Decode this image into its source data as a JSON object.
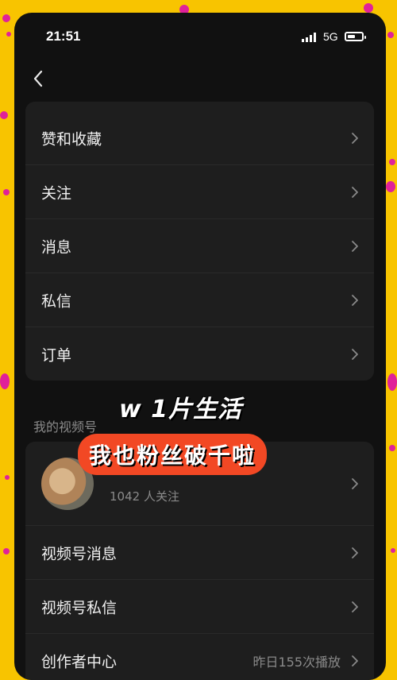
{
  "status_bar": {
    "time": "21:51",
    "network": "5G"
  },
  "menu_card": {
    "items": [
      {
        "label": "赞和收藏"
      },
      {
        "label": "关注"
      },
      {
        "label": "消息"
      },
      {
        "label": "私信"
      },
      {
        "label": "订单"
      }
    ]
  },
  "overlay": {
    "caption": "w 1片生活",
    "sticker": "我也粉丝破千啦"
  },
  "channel_section": {
    "title": "我的视频号",
    "profile": {
      "followers": "1042 人关注"
    },
    "items": [
      {
        "label": "视频号消息"
      },
      {
        "label": "视频号私信"
      },
      {
        "label": "创作者中心",
        "value": "昨日155次播放"
      }
    ]
  },
  "colors": {
    "background": "#f8c400",
    "card": "#1e1e1e",
    "sticker": "#f24824",
    "dots": "#e0219a"
  }
}
